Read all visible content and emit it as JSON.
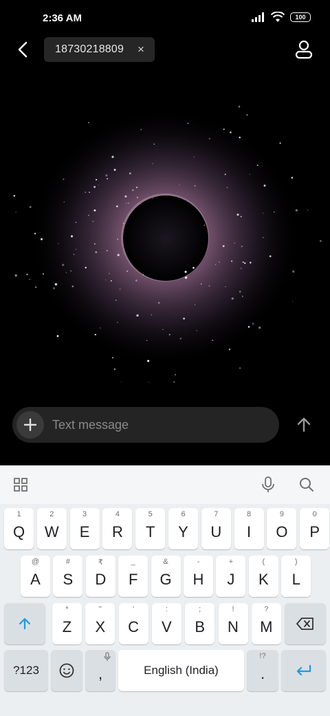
{
  "status_bar": {
    "time": "2:36 AM",
    "battery": "100"
  },
  "header": {
    "recipient": "18730218809",
    "chip_close": "×"
  },
  "composer": {
    "placeholder": "Text message"
  },
  "keyboard": {
    "row1": [
      {
        "key": "Q",
        "hint": "1"
      },
      {
        "key": "W",
        "hint": "2"
      },
      {
        "key": "E",
        "hint": "3"
      },
      {
        "key": "R",
        "hint": "4"
      },
      {
        "key": "T",
        "hint": "5"
      },
      {
        "key": "Y",
        "hint": "6"
      },
      {
        "key": "U",
        "hint": "7"
      },
      {
        "key": "I",
        "hint": "8"
      },
      {
        "key": "O",
        "hint": "9"
      },
      {
        "key": "P",
        "hint": "0"
      }
    ],
    "row2": [
      {
        "key": "A",
        "hint": "@"
      },
      {
        "key": "S",
        "hint": "#"
      },
      {
        "key": "D",
        "hint": "₹"
      },
      {
        "key": "F",
        "hint": "_"
      },
      {
        "key": "G",
        "hint": "&"
      },
      {
        "key": "H",
        "hint": "-"
      },
      {
        "key": "J",
        "hint": "+"
      },
      {
        "key": "K",
        "hint": "("
      },
      {
        "key": "L",
        "hint": ")"
      }
    ],
    "row3": [
      {
        "key": "Z",
        "hint": "*"
      },
      {
        "key": "X",
        "hint": "\""
      },
      {
        "key": "C",
        "hint": "'"
      },
      {
        "key": "V",
        "hint": ":"
      },
      {
        "key": "B",
        "hint": ";"
      },
      {
        "key": "N",
        "hint": "!"
      },
      {
        "key": "M",
        "hint": "?"
      }
    ],
    "symbols_key": "?123",
    "comma_key": ",",
    "space_label": "English (India)",
    "period_key": ".",
    "period_hint": "!?",
    "accent_color": "#1a9be6"
  }
}
